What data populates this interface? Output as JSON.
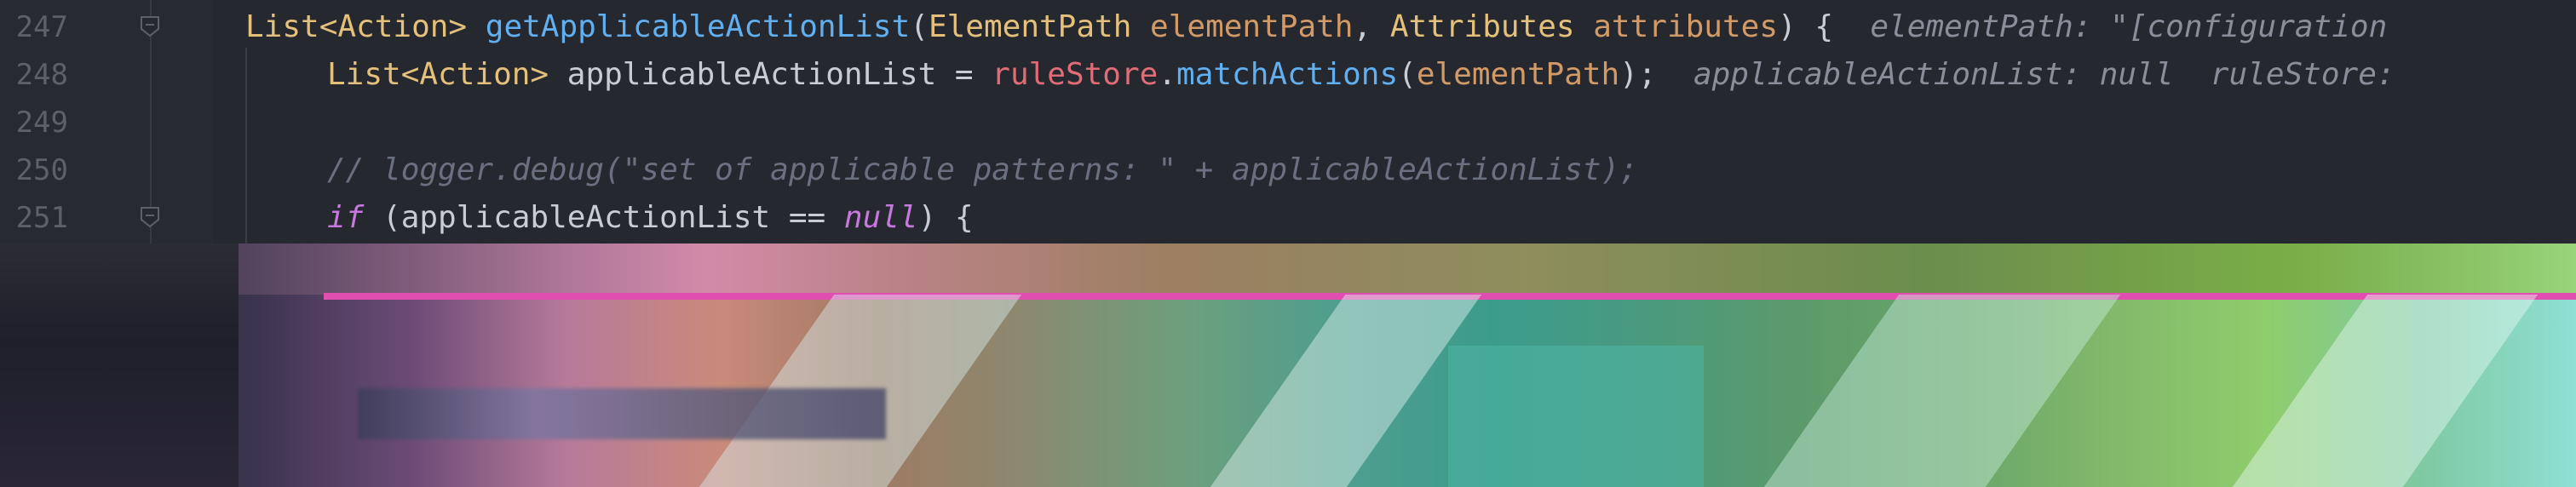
{
  "editor": {
    "lines": [
      {
        "number": "247",
        "fold_icon": "fold-marker-icon",
        "indent": 0,
        "tokens": [
          {
            "t": "List<Action> ",
            "c": "type"
          },
          {
            "t": "getApplicableActionList",
            "c": "method"
          },
          {
            "t": "(",
            "c": "plain"
          },
          {
            "t": "ElementPath ",
            "c": "type"
          },
          {
            "t": "elementPath",
            "c": "param"
          },
          {
            "t": ", ",
            "c": "plain"
          },
          {
            "t": "Attributes ",
            "c": "type"
          },
          {
            "t": "attributes",
            "c": "param"
          },
          {
            "t": ") {  ",
            "c": "plain"
          },
          {
            "t": "elementPath: \"[configuration",
            "c": "hint"
          }
        ]
      },
      {
        "number": "248",
        "fold_icon": "",
        "indent": 1,
        "tokens": [
          {
            "t": "List<Action> ",
            "c": "type"
          },
          {
            "t": "applicableActionList = ",
            "c": "plain"
          },
          {
            "t": "ruleStore",
            "c": "field"
          },
          {
            "t": ".",
            "c": "plain"
          },
          {
            "t": "matchActions",
            "c": "method"
          },
          {
            "t": "(",
            "c": "plain"
          },
          {
            "t": "elementPath",
            "c": "param"
          },
          {
            "t": ");  ",
            "c": "plain"
          },
          {
            "t": "applicableActionList: null  ruleStore:",
            "c": "hint"
          }
        ]
      },
      {
        "number": "249",
        "fold_icon": "",
        "indent": 1,
        "tokens": []
      },
      {
        "number": "250",
        "fold_icon": "",
        "indent": 1,
        "tokens": [
          {
            "t": "// logger.debug(\"set of applicable patterns: \" + applicableActionList);",
            "c": "comment"
          }
        ]
      },
      {
        "number": "251",
        "fold_icon": "fold-marker-icon",
        "indent": 1,
        "tokens": [
          {
            "t": "if",
            "c": "kw"
          },
          {
            "t": " (applicableActionList == ",
            "c": "plain"
          },
          {
            "t": "null",
            "c": "kw"
          },
          {
            "t": ") {",
            "c": "plain"
          }
        ]
      }
    ]
  },
  "colors": {
    "background": "#262830",
    "type": "#e5c07b",
    "method": "#61afef",
    "param": "#d19a66",
    "field": "#e06c75",
    "keyword": "#c678dd",
    "comment": "#6b7080",
    "hint": "#8a8e99",
    "line_number": "#5d6069"
  }
}
